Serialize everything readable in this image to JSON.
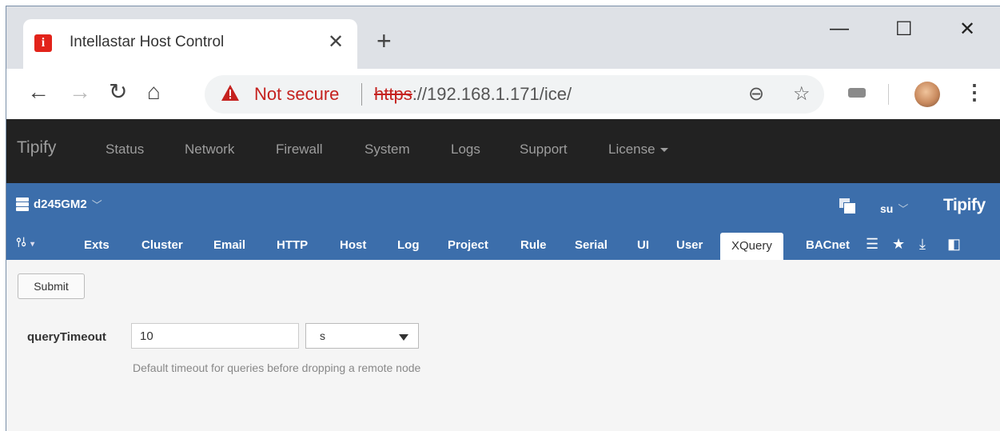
{
  "browser": {
    "tab_title": "Intellastar Host Control",
    "not_secure": "Not secure",
    "url_scheme": "https",
    "url_rest": "://192.168.1.171/ice/"
  },
  "appnav": {
    "brand": "Tipify",
    "items": [
      "Status",
      "Network",
      "Firewall",
      "System",
      "Logs",
      "Support",
      "License"
    ]
  },
  "header": {
    "server": "d245GM2",
    "user": "su",
    "logo": "Tipify"
  },
  "subtabs": [
    "Exts",
    "Cluster",
    "Email",
    "HTTP",
    "Host",
    "Log",
    "Project",
    "Rule",
    "Serial",
    "UI",
    "User",
    "XQuery",
    "BACnet"
  ],
  "active_tab": "XQuery",
  "form": {
    "submit_label": "Submit",
    "field_label": "queryTimeout",
    "field_value": "10",
    "unit": "s",
    "help": "Default timeout for queries before dropping a remote node"
  },
  "colors": {
    "nav_bg": "#222222",
    "blue_bar": "#3c6eab",
    "warning_red": "#c5221f"
  }
}
